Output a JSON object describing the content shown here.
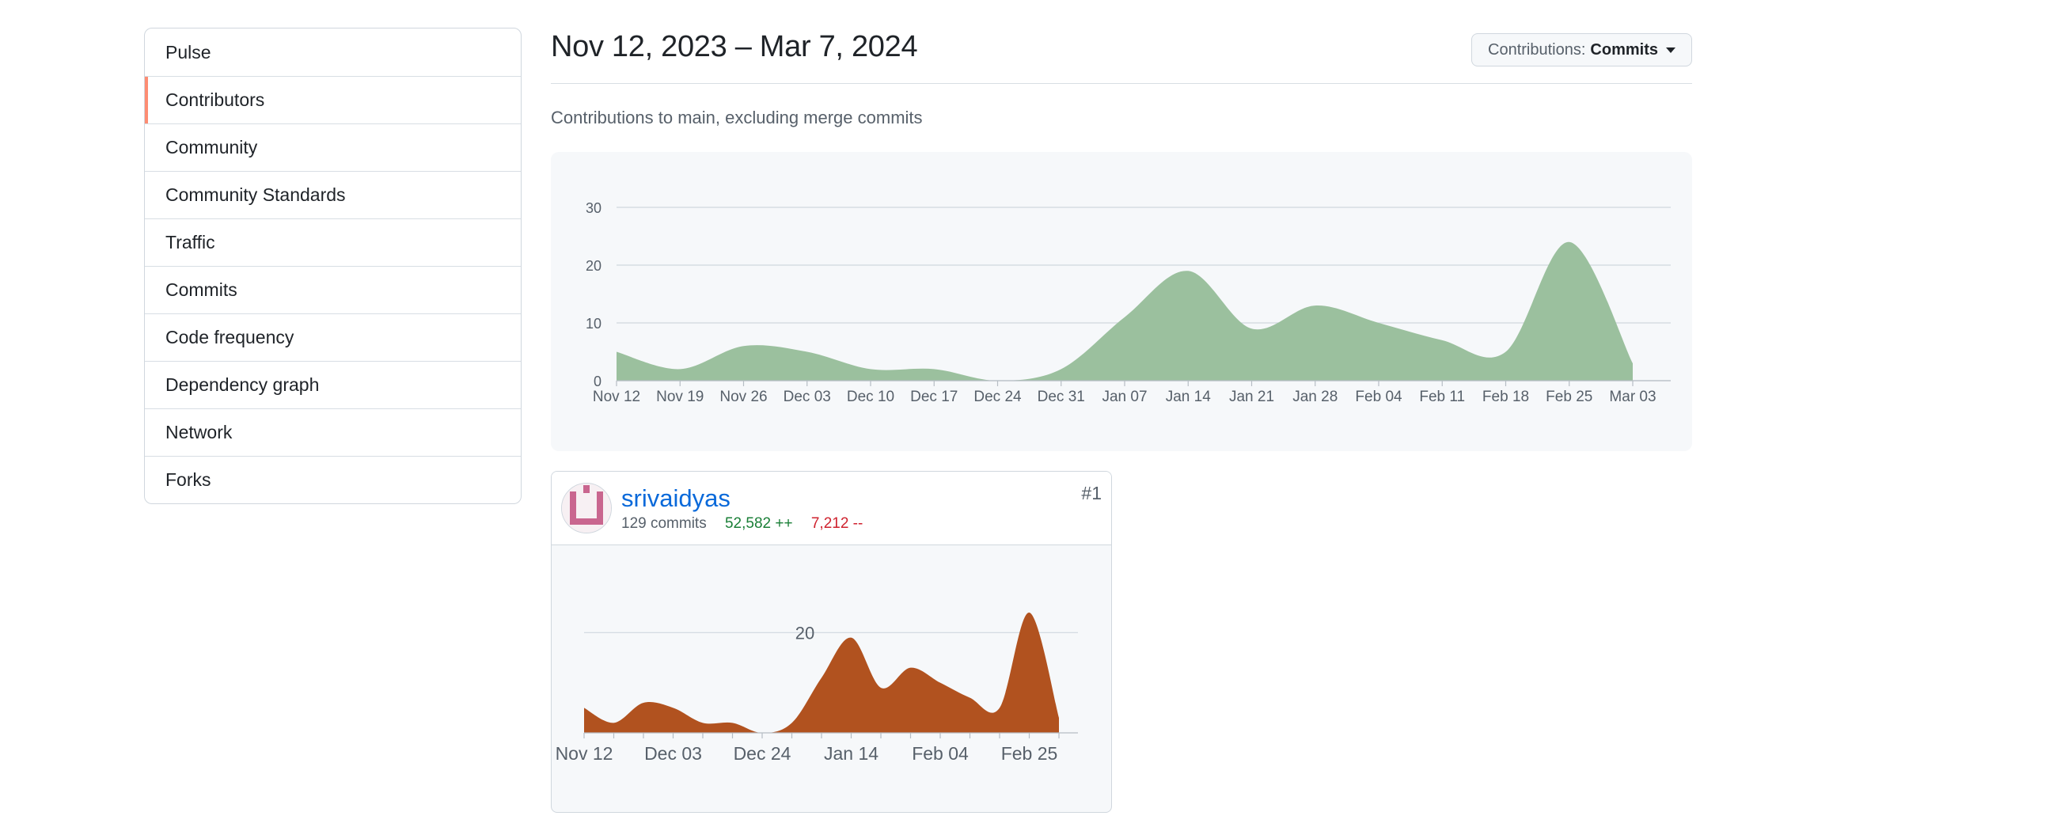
{
  "sidebar": {
    "items": [
      {
        "label": "Pulse"
      },
      {
        "label": "Contributors",
        "active": true
      },
      {
        "label": "Community"
      },
      {
        "label": "Community Standards"
      },
      {
        "label": "Traffic"
      },
      {
        "label": "Commits"
      },
      {
        "label": "Code frequency"
      },
      {
        "label": "Dependency graph"
      },
      {
        "label": "Network"
      },
      {
        "label": "Forks"
      }
    ]
  },
  "header": {
    "title": "Nov 12, 2023 – Mar 7, 2024",
    "dropdown_prefix": "Contributions:",
    "dropdown_value": "Commits",
    "subtitle": "Contributions to main, excluding merge commits"
  },
  "contributor": {
    "username": "srivaidyas",
    "commits": "129 commits",
    "additions": "52,582 ++",
    "deletions": "7,212 --",
    "rank": "#1"
  },
  "chart_data": [
    {
      "type": "area",
      "title": "",
      "xlabel": "",
      "ylabel": "",
      "color": "#9bc09e",
      "x": [
        "Nov 12",
        "Nov 19",
        "Nov 26",
        "Dec 03",
        "Dec 10",
        "Dec 17",
        "Dec 24",
        "Dec 31",
        "Jan 07",
        "Jan 14",
        "Jan 21",
        "Jan 28",
        "Feb 04",
        "Feb 11",
        "Feb 18",
        "Feb 25",
        "Mar 03"
      ],
      "y": [
        5,
        2,
        6,
        5,
        2,
        2,
        0,
        2,
        11,
        19,
        9,
        13,
        10,
        7,
        5,
        24,
        3
      ],
      "yticks": [
        0,
        10,
        20,
        30
      ],
      "ylim": [
        0,
        30
      ],
      "grid": true
    },
    {
      "type": "area",
      "title": "",
      "xlabel": "",
      "ylabel": "",
      "color": "#b1521f",
      "x": [
        "Nov 12",
        "Nov 19",
        "Nov 26",
        "Dec 03",
        "Dec 10",
        "Dec 17",
        "Dec 24",
        "Dec 31",
        "Jan 07",
        "Jan 14",
        "Jan 21",
        "Jan 28",
        "Feb 04",
        "Feb 11",
        "Feb 18",
        "Feb 25",
        "Mar 03"
      ],
      "y": [
        5,
        2,
        6,
        5,
        2,
        2,
        0,
        2,
        11,
        19,
        9,
        13,
        10,
        7,
        5,
        24,
        3
      ],
      "xtick_labels": [
        "Nov 12",
        "Dec 03",
        "Dec 24",
        "Jan 14",
        "Feb 04",
        "Feb 25"
      ],
      "yticks": [
        20
      ],
      "ylim": [
        0,
        24
      ],
      "grid": true
    }
  ]
}
